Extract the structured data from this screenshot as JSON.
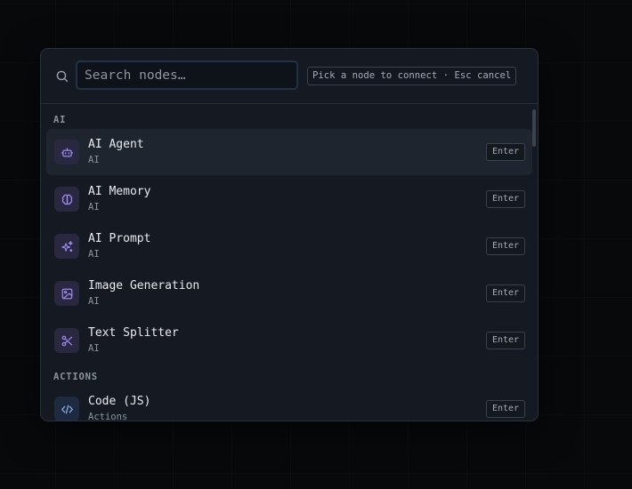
{
  "search": {
    "placeholder": "Search nodes…",
    "hint": "Pick a node to connect · Esc cancel"
  },
  "groups": [
    {
      "label": "AI",
      "items": [
        {
          "title": "AI Agent",
          "category": "AI",
          "shortcut": "Enter",
          "icon": "robot-icon"
        },
        {
          "title": "AI Memory",
          "category": "AI",
          "shortcut": "Enter",
          "icon": "brain-icon"
        },
        {
          "title": "AI Prompt",
          "category": "AI",
          "shortcut": "Enter",
          "icon": "sparkles-icon"
        },
        {
          "title": "Image Generation",
          "category": "AI",
          "shortcut": "Enter",
          "icon": "image-icon"
        },
        {
          "title": "Text Splitter",
          "category": "AI",
          "shortcut": "Enter",
          "icon": "scissors-icon"
        }
      ]
    },
    {
      "label": "ACTIONS",
      "items": [
        {
          "title": "Code (JS)",
          "category": "Actions",
          "shortcut": "Enter",
          "icon": "code-icon"
        }
      ]
    }
  ],
  "colors": {
    "accent_purple": "#9d8cf0",
    "accent_blue": "#8fb0ef",
    "panel": "#151a22",
    "active_row": "#1f252e"
  }
}
